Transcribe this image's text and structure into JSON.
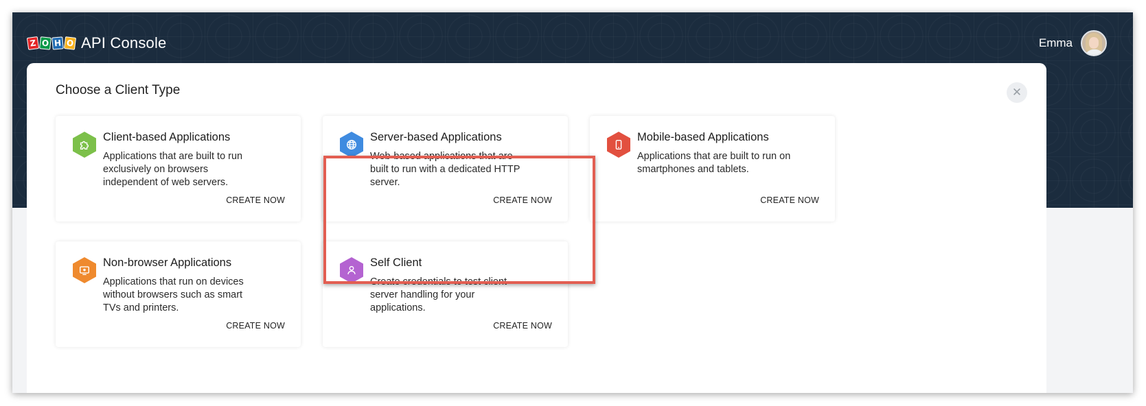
{
  "header": {
    "logo_letters": [
      "Z",
      "O",
      "H",
      "O"
    ],
    "app_title": "API Console",
    "user_name": "Emma"
  },
  "panel": {
    "title": "Choose a Client Type",
    "close_icon": "close-icon"
  },
  "cards": [
    {
      "title": "Client-based Applications",
      "description": "Applications that are built to run exclusively on browsers independent of web servers.",
      "action": "CREATE NOW",
      "icon": "puzzle-icon",
      "color": "#7cc04a"
    },
    {
      "title": "Server-based Applications",
      "description": "Web-based applications that are built to run with a dedicated HTTP server.",
      "action": "CREATE NOW",
      "icon": "globe-icon",
      "color": "#3f8be0"
    },
    {
      "title": "Mobile-based Applications",
      "description": "Applications that are built to run on smartphones and tablets.",
      "action": "CREATE NOW",
      "icon": "phone-icon",
      "color": "#e2503f"
    },
    {
      "title": "Non-browser Applications",
      "description": "Applications that run on devices without browsers such as smart TVs and printers.",
      "action": "CREATE NOW",
      "icon": "tv-icon",
      "color": "#ef8a2e"
    },
    {
      "title": "Self Client",
      "description": "Create credentials to test client-server handling for your applications.",
      "action": "CREATE NOW",
      "icon": "user-icon",
      "color": "#b463d1"
    }
  ],
  "highlight_color": "#e25e52"
}
